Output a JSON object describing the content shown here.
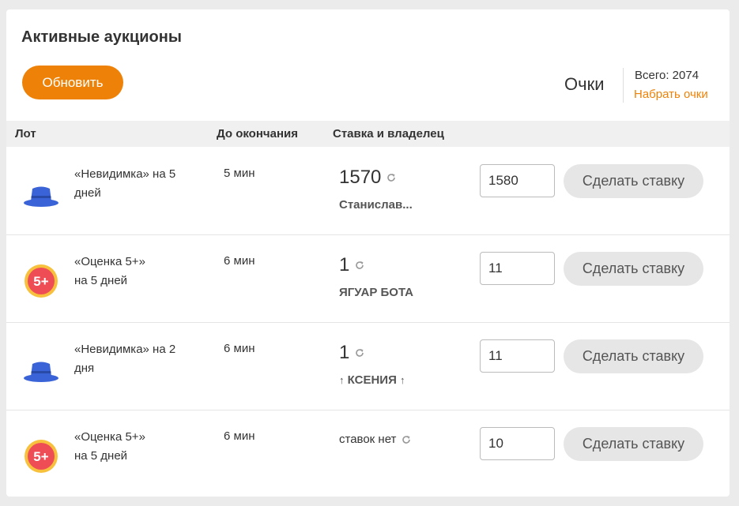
{
  "title": "Активные аукционы",
  "refresh_label": "Обновить",
  "points": {
    "label": "Очки",
    "total": "Всего: 2074",
    "link": "Набрать очки"
  },
  "columns": {
    "lot": "Лот",
    "time": "До окончания",
    "bid": "Ставка и владелец"
  },
  "rows": [
    {
      "icon": "blue-hat-icon",
      "name": "«Невидимка» на 5 дней",
      "time": "5 мин",
      "bid": "1570",
      "owner": "Станислав...",
      "input_value": "1580",
      "button": "Сделать ставку"
    },
    {
      "icon": "grade-5plus-icon",
      "name": "«Оценка 5+» на 5 дней",
      "time": "6 мин",
      "bid": "1",
      "owner": "ЯГУАР БОТА",
      "input_value": "11",
      "button": "Сделать ставку"
    },
    {
      "icon": "blue-hat-icon",
      "name": "«Невидимка» на 2 дня",
      "time": "6 мин",
      "bid": "1",
      "owner": "КСЕНИЯ",
      "owner_decor": "↑",
      "input_value": "11",
      "button": "Сделать ставку"
    },
    {
      "icon": "grade-5plus-icon",
      "name": "«Оценка 5+» на 5 дней",
      "time": "6 мин",
      "bid": "ставок нет",
      "owner": "",
      "input_value": "10",
      "button": "Сделать ставку"
    }
  ],
  "colors": {
    "accent": "#ee8208",
    "hat": "#3a63d8",
    "badge_red": "#ef4d55",
    "badge_ring": "#f7c13e"
  }
}
